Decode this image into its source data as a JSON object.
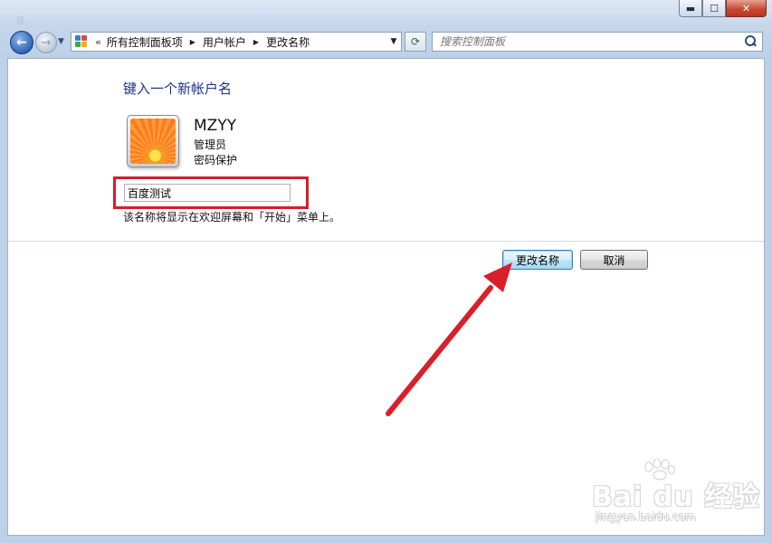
{
  "window": {
    "title_faint": "器...",
    "caption": {
      "minimize": "▬",
      "maximize": "☐",
      "close": "✕"
    }
  },
  "nav": {
    "back_glyph": "←",
    "forward_glyph": "→",
    "dropdown_glyph": "▼",
    "address": {
      "overflow": "«",
      "crumbs": [
        "所有控制面板项",
        "用户帐户",
        "更改名称"
      ],
      "separator": "▶",
      "dropdown_glyph": "▼"
    },
    "refresh_glyph": "⟳",
    "search": {
      "placeholder": "搜索控制面板"
    }
  },
  "main": {
    "heading": "键入一个新帐户名",
    "account": {
      "name": "MZYY",
      "role": "管理员",
      "protection": "密码保护"
    },
    "new_name_value": "百度测试",
    "hint": "该名称将显示在欢迎屏幕和「开始」菜单上。",
    "buttons": {
      "confirm": "更改名称",
      "cancel": "取消"
    }
  },
  "watermark": {
    "logo": "Bai du 经验",
    "url": "jingyan.baidu.com"
  },
  "colors": {
    "heading": "#1e3287",
    "highlight": "#d0202b",
    "arrow": "#d8202a"
  }
}
